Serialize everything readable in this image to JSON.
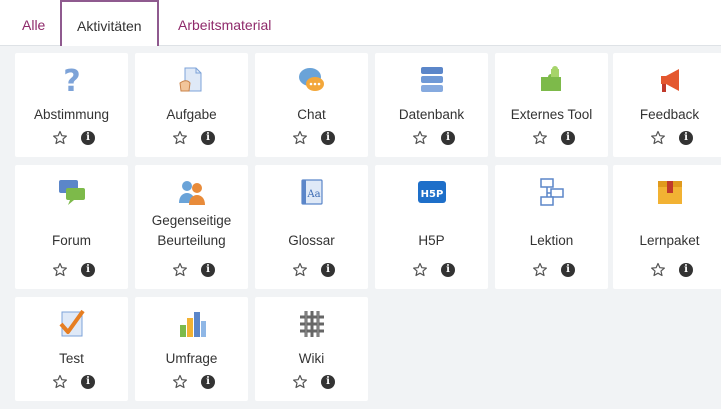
{
  "tabs": [
    {
      "label": "Alle"
    },
    {
      "label": "Aktivitäten"
    },
    {
      "label": "Arbeitsmaterial"
    }
  ],
  "modules": [
    {
      "name": "Abstimmung",
      "icon": "question-icon"
    },
    {
      "name": "Aufgabe",
      "icon": "assignment-icon"
    },
    {
      "name": "Chat",
      "icon": "chat-icon"
    },
    {
      "name": "Datenbank",
      "icon": "database-icon"
    },
    {
      "name": "Externes Tool",
      "icon": "puzzle-icon"
    },
    {
      "name": "Feedback",
      "icon": "megaphone-icon"
    },
    {
      "name": "Forum",
      "icon": "forum-icon"
    },
    {
      "name": "Gegenseitige",
      "name2": "Beurteilung",
      "icon": "workshop-icon"
    },
    {
      "name": "Glossar",
      "icon": "glossary-icon"
    },
    {
      "name": "H5P",
      "icon": "h5p-icon"
    },
    {
      "name": "Lektion",
      "icon": "lesson-icon"
    },
    {
      "name": "Lernpaket",
      "icon": "package-icon"
    },
    {
      "name": "Test",
      "icon": "quiz-icon"
    },
    {
      "name": "Umfrage",
      "icon": "survey-icon"
    },
    {
      "name": "Wiki",
      "icon": "wiki-icon"
    }
  ],
  "icons": {
    "star": "star-outline-icon",
    "info": "info-icon"
  },
  "colors": {
    "accent": "#8f2a6b",
    "active_border": "#8f5a8f",
    "grid_bg": "#f1f3f5"
  }
}
